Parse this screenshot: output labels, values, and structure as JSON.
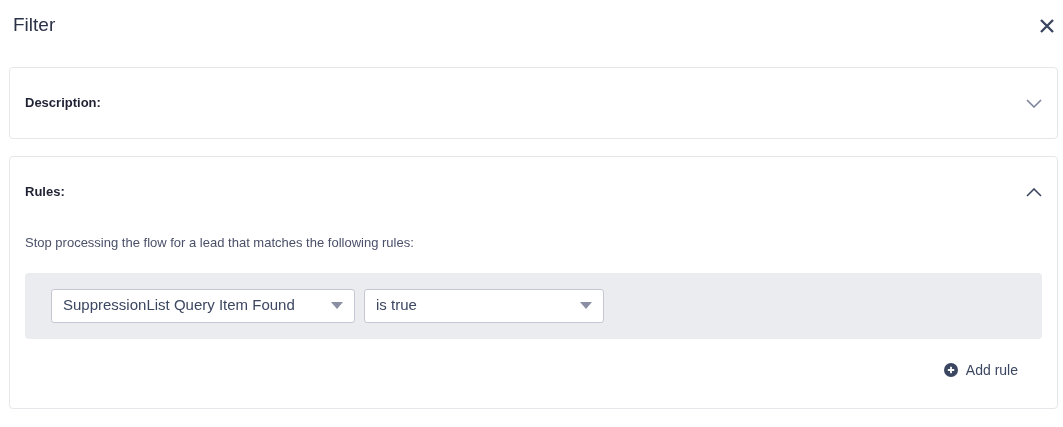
{
  "dialog": {
    "title": "Filter"
  },
  "sections": [
    {
      "title": "Description:",
      "expanded": false
    },
    {
      "title": "Rules:",
      "expanded": true,
      "intro": "Stop processing the flow for a lead that matches the following rules:",
      "rules": [
        {
          "field": "SuppressionList Query Item Found",
          "condition": "is true"
        }
      ],
      "add_button": "Add rule"
    }
  ]
}
